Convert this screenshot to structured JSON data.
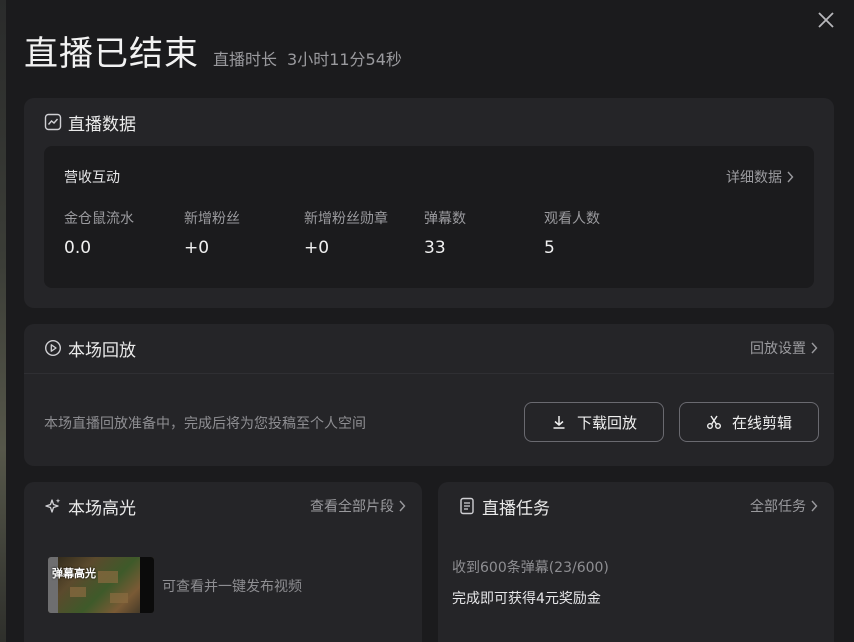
{
  "header": {
    "title": "直播已结束",
    "duration_label": "直播时长",
    "duration_value": "3小时11分54秒"
  },
  "stats": {
    "title": "直播数据",
    "section_label": "营收互动",
    "detail_link": "详细数据",
    "items": [
      {
        "label": "金仓鼠流水",
        "value": "0.0"
      },
      {
        "label": "新增粉丝",
        "value": "+0"
      },
      {
        "label": "新增粉丝勋章",
        "value": "+0"
      },
      {
        "label": "弹幕数",
        "value": "33"
      },
      {
        "label": "观看人数",
        "value": "5"
      }
    ]
  },
  "replay": {
    "title": "本场回放",
    "settings_link": "回放设置",
    "description": "本场直播回放准备中，完成后将为您投稿至个人空间",
    "download_button": "下载回放",
    "edit_button": "在线剪辑"
  },
  "highlight": {
    "title": "本场高光",
    "view_all_link": "查看全部片段",
    "thumb_badge": "弹幕高光",
    "text": "可查看并一键发布视频"
  },
  "tasks": {
    "title": "直播任务",
    "all_link": "全部任务",
    "progress": "收到600条弹幕(23/600)",
    "reward": "完成即可获得4元奖励金"
  }
}
